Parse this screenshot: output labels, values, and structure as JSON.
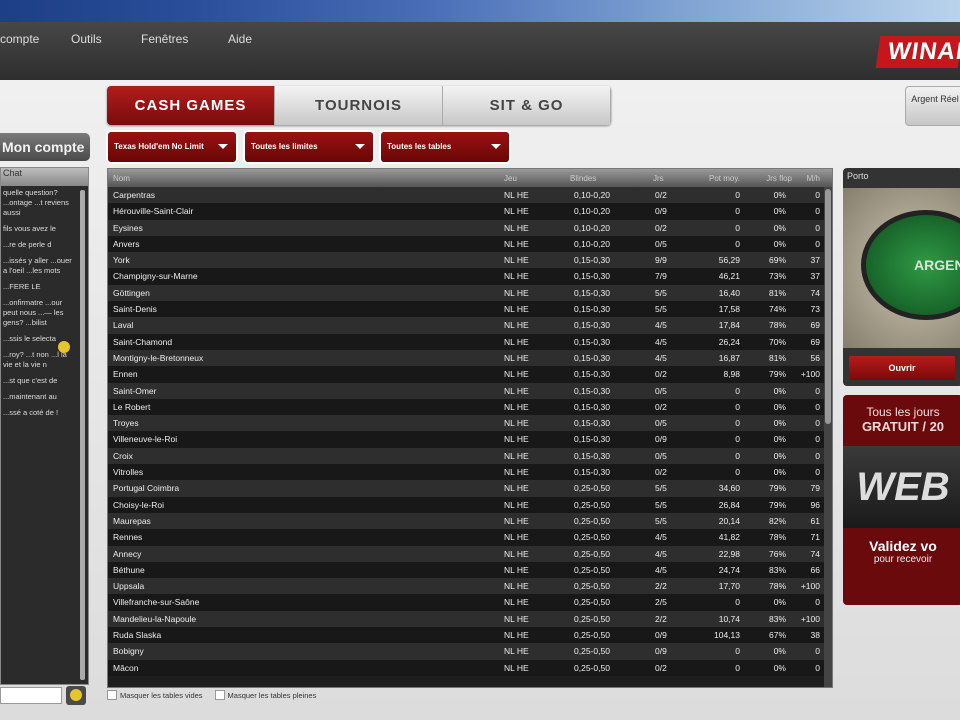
{
  "menu": {
    "items": [
      "compte",
      "Outils",
      "Fenêtres",
      "Aide"
    ],
    "logo": "WINAMAX"
  },
  "account": {
    "button": "Mon compte",
    "chat_title": "Chat",
    "messages": [
      "quelle question? ...ontage ...t reviens aussi",
      "fils vous avez le",
      "...re de perle d",
      "...issés y aller ...ouer a l'oeil ...les mots",
      "...FERE LE",
      "...onfirmatre ...our peut nous ...— les gens? ...bilist",
      "...ssis le selecta",
      "...roy? ...t non ...l la vie et la vie n",
      "...st que c'est de",
      "...maintenant au",
      "...ssé a coté de !"
    ]
  },
  "tabs": [
    {
      "label": "CASH GAMES",
      "active": true
    },
    {
      "label": "TOURNOIS",
      "active": false
    },
    {
      "label": "SIT & GO",
      "active": false
    }
  ],
  "filters": [
    "Texas Hold'em No Limit",
    "Toutes les limites",
    "Toutes les tables"
  ],
  "table": {
    "headers": {
      "name": "Nom",
      "game": "Jeu",
      "blinds": "Blindes",
      "players": "Jrs",
      "avg_pot": "Pot moy.",
      "flop": "Jrs flop",
      "hands": "M/h"
    },
    "rows": [
      [
        "Carpentras",
        "NL HE",
        "0,10-0,20",
        "0/2",
        "0",
        "0%",
        "0"
      ],
      [
        "Hérouville-Saint-Clair",
        "NL HE",
        "0,10-0,20",
        "0/9",
        "0",
        "0%",
        "0"
      ],
      [
        "Eysines",
        "NL HE",
        "0,10-0,20",
        "0/2",
        "0",
        "0%",
        "0"
      ],
      [
        "Anvers",
        "NL HE",
        "0,10-0,20",
        "0/5",
        "0",
        "0%",
        "0"
      ],
      [
        "York",
        "NL HE",
        "0,15-0,30",
        "9/9",
        "56,29",
        "69%",
        "37"
      ],
      [
        "Champigny-sur-Marne",
        "NL HE",
        "0,15-0,30",
        "7/9",
        "46,21",
        "73%",
        "37"
      ],
      [
        "Göttingen",
        "NL HE",
        "0,15-0,30",
        "5/5",
        "16,40",
        "81%",
        "74"
      ],
      [
        "Saint-Denis",
        "NL HE",
        "0,15-0,30",
        "5/5",
        "17,58",
        "74%",
        "73"
      ],
      [
        "Laval",
        "NL HE",
        "0,15-0,30",
        "4/5",
        "17,84",
        "78%",
        "69"
      ],
      [
        "Saint-Chamond",
        "NL HE",
        "0,15-0,30",
        "4/5",
        "26,24",
        "70%",
        "69"
      ],
      [
        "Montigny-le-Bretonneux",
        "NL HE",
        "0,15-0,30",
        "4/5",
        "16,87",
        "81%",
        "56"
      ],
      [
        "Ennen",
        "NL HE",
        "0,15-0,30",
        "0/2",
        "8,98",
        "79%",
        "+100"
      ],
      [
        "Saint-Omer",
        "NL HE",
        "0,15-0,30",
        "0/5",
        "0",
        "0%",
        "0"
      ],
      [
        "Le Robert",
        "NL HE",
        "0,15-0,30",
        "0/2",
        "0",
        "0%",
        "0"
      ],
      [
        "Troyes",
        "NL HE",
        "0,15-0,30",
        "0/5",
        "0",
        "0%",
        "0"
      ],
      [
        "Villeneuve-le-Roi",
        "NL HE",
        "0,15-0,30",
        "0/9",
        "0",
        "0%",
        "0"
      ],
      [
        "Croix",
        "NL HE",
        "0,15-0,30",
        "0/5",
        "0",
        "0%",
        "0"
      ],
      [
        "Vitrolles",
        "NL HE",
        "0,15-0,30",
        "0/2",
        "0",
        "0%",
        "0"
      ],
      [
        "Portugal Coimbra",
        "NL HE",
        "0,25-0,50",
        "5/5",
        "34,60",
        "79%",
        "79"
      ],
      [
        "Choisy-le-Roi",
        "NL HE",
        "0,25-0,50",
        "5/5",
        "26,84",
        "79%",
        "96"
      ],
      [
        "Maurepas",
        "NL HE",
        "0,25-0,50",
        "5/5",
        "20,14",
        "82%",
        "61"
      ],
      [
        "Rennes",
        "NL HE",
        "0,25-0,50",
        "4/5",
        "41,82",
        "78%",
        "71"
      ],
      [
        "Annecy",
        "NL HE",
        "0,25-0,50",
        "4/5",
        "22,98",
        "76%",
        "74"
      ],
      [
        "Béthune",
        "NL HE",
        "0,25-0,50",
        "4/5",
        "24,74",
        "83%",
        "66"
      ],
      [
        "Uppsala",
        "NL HE",
        "0,25-0,50",
        "2/2",
        "17,70",
        "78%",
        "+100"
      ],
      [
        "Villefranche-sur-Saône",
        "NL HE",
        "0,25-0,50",
        "2/5",
        "0",
        "0%",
        "0"
      ],
      [
        "Mandelieu-la-Napoule",
        "NL HE",
        "0,25-0,50",
        "2/2",
        "10,74",
        "83%",
        "+100"
      ],
      [
        "Ruda Slaska",
        "NL HE",
        "0,25-0,50",
        "0/9",
        "104,13",
        "67%",
        "38"
      ],
      [
        "Bobigny",
        "NL HE",
        "0,25-0,50",
        "0/9",
        "0",
        "0%",
        "0"
      ],
      [
        "Mâcon",
        "NL HE",
        "0,25-0,50",
        "0/2",
        "0",
        "0%",
        "0"
      ]
    ]
  },
  "options": {
    "hide_empty": "Masquer les tables vides",
    "hide_full": "Masquer les tables pleines"
  },
  "right": {
    "mode_button": "Argent Réel",
    "preview_title": "Porto",
    "preview_felt": "ARGENT",
    "open_button": "Ouvrir",
    "ad": {
      "line1": "Tous les jours",
      "line2": "GRATUIT / 20",
      "brand": "WEB",
      "line3": "Validez vo",
      "line4": "pour recevoir"
    }
  }
}
